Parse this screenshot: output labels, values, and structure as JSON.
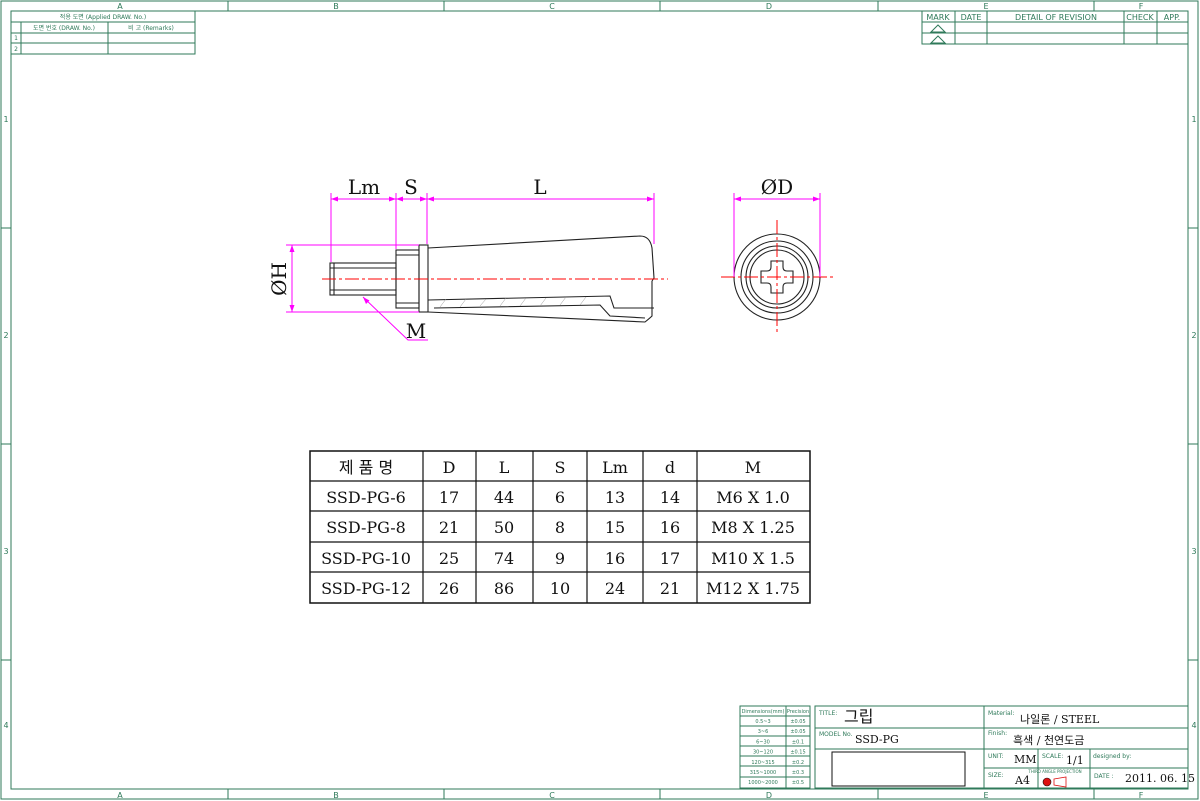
{
  "sheet": {
    "zone_letters": [
      "A",
      "B",
      "C",
      "D",
      "E",
      "F"
    ],
    "zone_numbers": [
      "1",
      "2",
      "3",
      "4"
    ]
  },
  "applied_box": {
    "title": "적용 도면 (Applied DRAW. No.)",
    "col1": "도면 번호 (DRAW. No.)",
    "col2": "비 고 (Remarks)",
    "rows": [
      "1",
      "2"
    ]
  },
  "revision": {
    "headers": [
      "MARK",
      "DATE",
      "DETAIL OF REVISION",
      "CHECK",
      "APP."
    ]
  },
  "dims": {
    "lm": "Lm",
    "s": "S",
    "l": "L",
    "h": "ØH",
    "m": "M",
    "d": "ØD"
  },
  "spec_table": {
    "headers": [
      "제 품 명",
      "D",
      "L",
      "S",
      "Lm",
      "d",
      "M"
    ],
    "rows": [
      [
        "SSD-PG-6",
        "17",
        "44",
        "6",
        "13",
        "14",
        "M6 X 1.0"
      ],
      [
        "SSD-PG-8",
        "21",
        "50",
        "8",
        "15",
        "16",
        "M8 X 1.25"
      ],
      [
        "SSD-PG-10",
        "25",
        "74",
        "9",
        "16",
        "17",
        "M10 X 1.5"
      ],
      [
        "SSD-PG-12",
        "26",
        "86",
        "10",
        "24",
        "21",
        "M12 X 1.75"
      ]
    ]
  },
  "tolerance": {
    "headers": [
      "Dimensions(mm)",
      "Precision"
    ],
    "rows": [
      [
        "0.5~3",
        "±0.05"
      ],
      [
        "3~6",
        "±0.05"
      ],
      [
        "6~30",
        "±0.1"
      ],
      [
        "30~120",
        "±0.15"
      ],
      [
        "120~315",
        "±0.2"
      ],
      [
        "315~1000",
        "±0.3"
      ],
      [
        "1000~2000",
        "±0.5"
      ]
    ]
  },
  "title_block": {
    "title_label": "TITLE:",
    "title": "그립",
    "model_label": "MODEL No.",
    "model": "SSD-PG",
    "material_label": "Material:",
    "material": "나일론 / STEEL",
    "finish_label": "Finish:",
    "finish": "흑색 / 천연도금",
    "unit_label": "UNIT:",
    "unit": "MM",
    "scale_label": "SCALE:",
    "scale": "1/1",
    "designed_label": "designed by:",
    "size_label": "SIZE:",
    "size": "A4",
    "projection_label": "THIRD ANGLE PROJECTION",
    "date_label": "DATE :",
    "date": "2011. 06. 15"
  }
}
